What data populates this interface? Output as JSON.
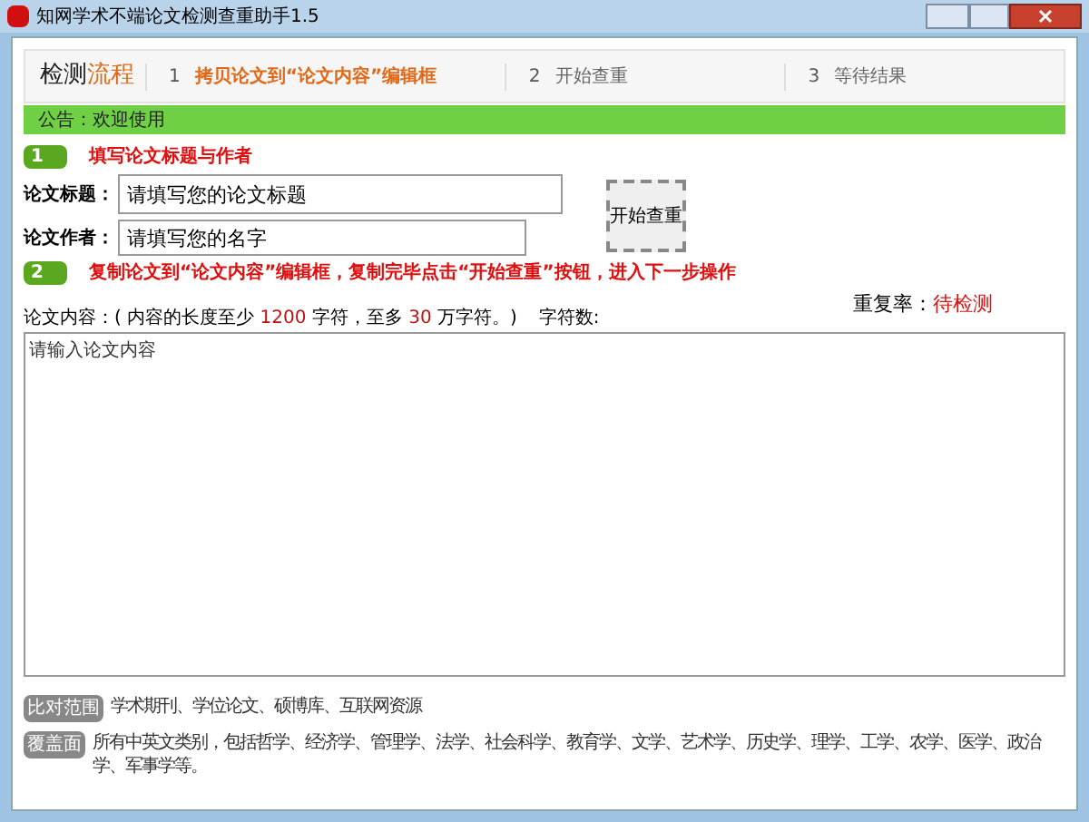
{
  "window": {
    "title": "知网学术不端论文检测查重助手1.5"
  },
  "flow": {
    "title_plain": "检测",
    "title_accent": "流程",
    "steps": [
      {
        "number": "1",
        "label": "拷贝论文到“论文内容”编辑框",
        "selected": true
      },
      {
        "number": "2",
        "label": "开始查重",
        "selected": false
      },
      {
        "number": "3",
        "label": "等待结果",
        "selected": false
      }
    ]
  },
  "notice": "公告：欢迎使用",
  "step_one": {
    "badge": "1",
    "heading": "填写论文标题与作者"
  },
  "form": {
    "title_label": "论文标题：",
    "title_value": "请填写您的论文标题",
    "author_label": "论文作者：",
    "author_value": "请填写您的名字",
    "start_button": "开始查重"
  },
  "step_two": {
    "badge": "2",
    "heading": "复制论文到“论文内容”编辑框，复制完毕点击“开始查重”按钮，进入下一步操作"
  },
  "content": {
    "hint_parts": [
      "论文内容：( 内容的长度至少 ",
      "1200",
      " 字符，至多 ",
      "30",
      " 万字符。)"
    ],
    "count_label": "字符数:",
    "rate_label": "重复率：",
    "rate_value": "待检测",
    "placeholder": "请输入论文内容"
  },
  "footer": [
    {
      "tag": "比对范围",
      "text": "学术期刊、学位论文、硕博库、互联网资源"
    },
    {
      "tag": "覆盖面",
      "text": "所有中英文类别，包括哲学、经济学、管理学、法学、社会科学、教育学、文学、艺术学、历史学、理学、工学、农学、医学、政治学、军事学等。"
    }
  ]
}
